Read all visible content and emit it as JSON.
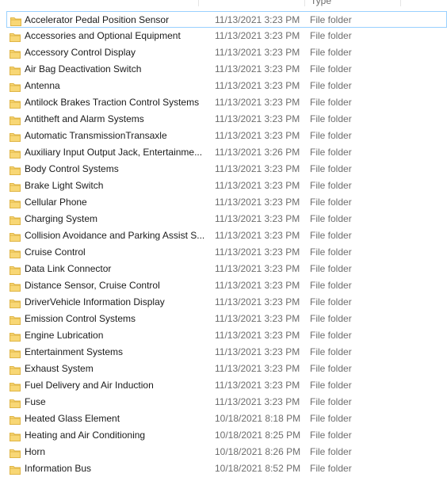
{
  "header": {
    "type_stub": "Type"
  },
  "colors": {
    "folder_yellow": "#F8D775",
    "folder_dark": "#E0B545",
    "name_text": "#1B1B1B",
    "meta_text": "#6D6D6D",
    "selection_border": "#99D1FF"
  },
  "icons": {
    "folder": "folder-icon"
  },
  "files": [
    {
      "name": "Accelerator Pedal Position Sensor",
      "date": "11/13/2021 3:23 PM",
      "type": "File folder"
    },
    {
      "name": "Accessories and Optional Equipment",
      "date": "11/13/2021 3:23 PM",
      "type": "File folder"
    },
    {
      "name": "Accessory Control Display",
      "date": "11/13/2021 3:23 PM",
      "type": "File folder"
    },
    {
      "name": "Air Bag Deactivation Switch",
      "date": "11/13/2021 3:23 PM",
      "type": "File folder"
    },
    {
      "name": "Antenna",
      "date": "11/13/2021 3:23 PM",
      "type": "File folder"
    },
    {
      "name": "Antilock Brakes  Traction Control Systems",
      "date": "11/13/2021 3:23 PM",
      "type": "File folder"
    },
    {
      "name": "Antitheft and Alarm Systems",
      "date": "11/13/2021 3:23 PM",
      "type": "File folder"
    },
    {
      "name": "Automatic TransmissionTransaxle",
      "date": "11/13/2021 3:23 PM",
      "type": "File folder"
    },
    {
      "name": "Auxiliary Input  Output Jack, Entertainme...",
      "date": "11/13/2021 3:26 PM",
      "type": "File folder"
    },
    {
      "name": "Body Control Systems",
      "date": "11/13/2021 3:23 PM",
      "type": "File folder"
    },
    {
      "name": "Brake Light Switch",
      "date": "11/13/2021 3:23 PM",
      "type": "File folder"
    },
    {
      "name": "Cellular Phone",
      "date": "11/13/2021 3:23 PM",
      "type": "File folder"
    },
    {
      "name": "Charging System",
      "date": "11/13/2021 3:23 PM",
      "type": "File folder"
    },
    {
      "name": "Collision Avoidance and Parking Assist S...",
      "date": "11/13/2021 3:23 PM",
      "type": "File folder"
    },
    {
      "name": "Cruise Control",
      "date": "11/13/2021 3:23 PM",
      "type": "File folder"
    },
    {
      "name": "Data Link Connector",
      "date": "11/13/2021 3:23 PM",
      "type": "File folder"
    },
    {
      "name": "Distance Sensor, Cruise Control",
      "date": "11/13/2021 3:23 PM",
      "type": "File folder"
    },
    {
      "name": "DriverVehicle Information Display",
      "date": "11/13/2021 3:23 PM",
      "type": "File folder"
    },
    {
      "name": "Emission Control Systems",
      "date": "11/13/2021 3:23 PM",
      "type": "File folder"
    },
    {
      "name": "Engine Lubrication",
      "date": "11/13/2021 3:23 PM",
      "type": "File folder"
    },
    {
      "name": "Entertainment Systems",
      "date": "11/13/2021 3:23 PM",
      "type": "File folder"
    },
    {
      "name": "Exhaust System",
      "date": "11/13/2021 3:23 PM",
      "type": "File folder"
    },
    {
      "name": "Fuel Delivery and Air Induction",
      "date": "11/13/2021 3:23 PM",
      "type": "File folder"
    },
    {
      "name": "Fuse",
      "date": "11/13/2021 3:23 PM",
      "type": "File folder"
    },
    {
      "name": "Heated Glass Element",
      "date": "10/18/2021 8:18 PM",
      "type": "File folder"
    },
    {
      "name": "Heating and Air Conditioning",
      "date": "10/18/2021 8:25 PM",
      "type": "File folder"
    },
    {
      "name": "Horn",
      "date": "10/18/2021 8:26 PM",
      "type": "File folder"
    },
    {
      "name": "Information Bus",
      "date": "10/18/2021 8:52 PM",
      "type": "File folder"
    }
  ]
}
